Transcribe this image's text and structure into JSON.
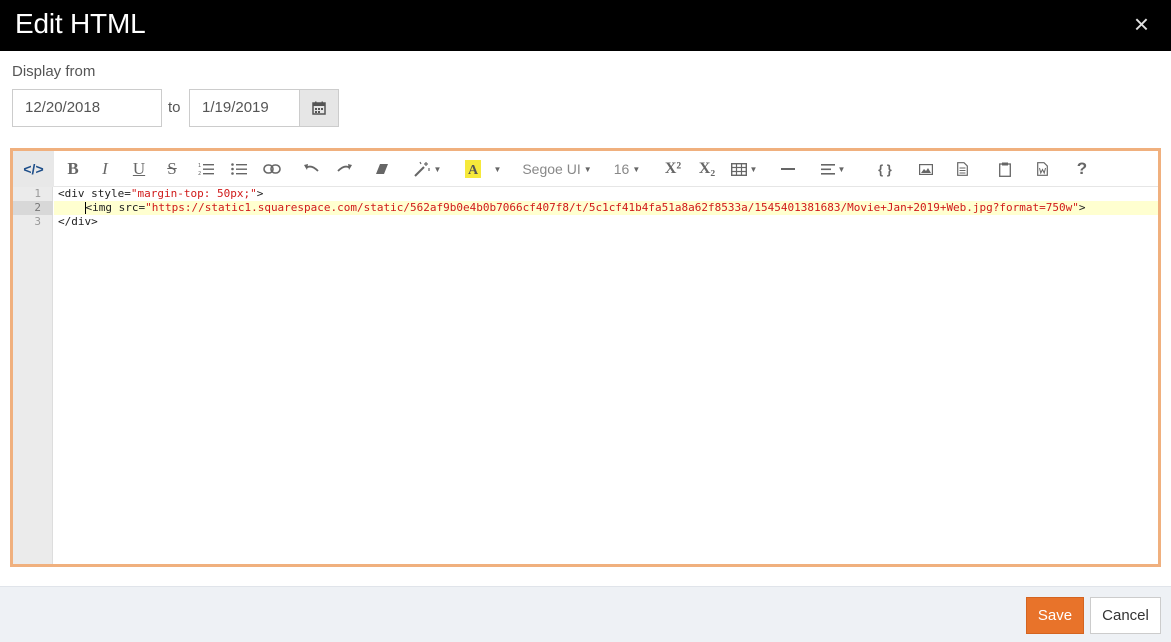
{
  "modal": {
    "title": "Edit HTML",
    "close_glyph": "×"
  },
  "display": {
    "label": "Display from",
    "from_value": "12/20/2018",
    "to_label": "to",
    "to_value": "1/19/2019"
  },
  "toolbar": {
    "code_view": "</>",
    "bold": "B",
    "italic": "I",
    "underline": "U",
    "strikethrough": "S",
    "font_name": "Segoe UI",
    "font_size": "16",
    "superscript": "X²",
    "subscript": "X₂",
    "code_block": "{ }",
    "help": "?"
  },
  "editor": {
    "line_numbers": [
      "1",
      "2",
      "3"
    ],
    "line1_tag": "<div style=",
    "line1_str": "\"margin-top: 50px;\"",
    "line1_end": ">",
    "line2_tag": "<img src=",
    "line2_str": "\"https://static1.squarespace.com/static/562af9b0e4b0b7066cf407f8/t/5c1cf41b4fa51a8a62f8533a/1545401381683/Movie+Jan+2019+Web.jpg?format=750w\"",
    "line2_end": ">",
    "line3": "</div>"
  },
  "footer": {
    "save_label": "Save",
    "cancel_label": "Cancel"
  },
  "colors": {
    "header_bg": "#000000",
    "accent": "#e8732a",
    "editor_border": "#f0b07e"
  }
}
